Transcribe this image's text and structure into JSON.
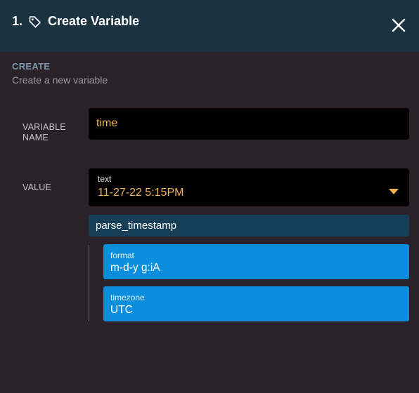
{
  "header": {
    "step_number": "1.",
    "title": "Create Variable",
    "icon": "tag-icon",
    "close_icon": "close-icon"
  },
  "section": {
    "label": "CREATE",
    "description": "Create a new variable"
  },
  "fields": {
    "name_label": "VARIABLE NAME",
    "name_value": "time",
    "value_label": "VALUE",
    "value_type": "text",
    "value_value": "11-27-22 5:15PM"
  },
  "function": {
    "name": "parse_timestamp",
    "params": [
      {
        "label": "format",
        "value": "m-d-y g:iA"
      },
      {
        "label": "timezone",
        "value": "UTC"
      }
    ]
  },
  "colors": {
    "header_bg": "#1b3340",
    "panel_bg": "#2a2228",
    "accent_value": "#f2b24d",
    "function_bar": "#173f57",
    "param_bg": "#0b8fdc"
  }
}
